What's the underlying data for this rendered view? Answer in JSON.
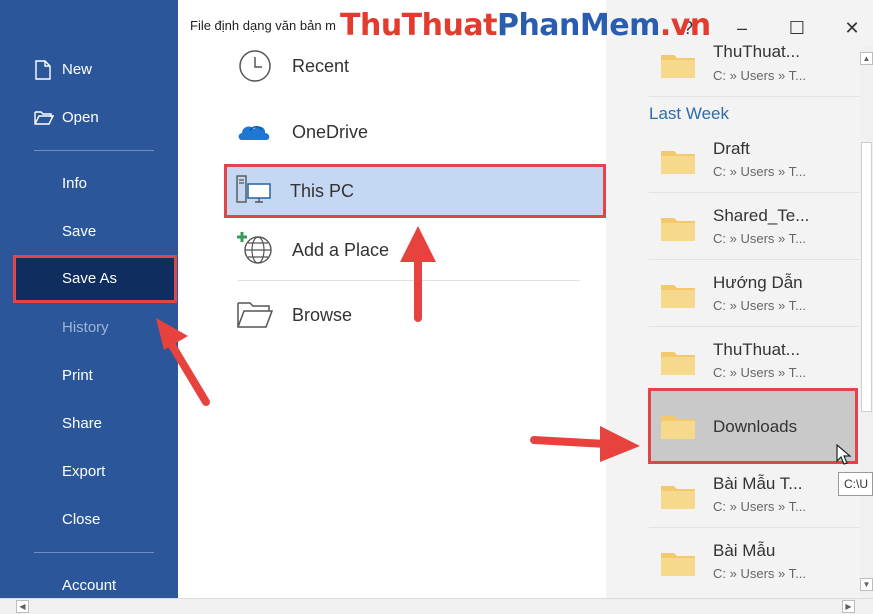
{
  "window": {
    "doc_title": "File định dạng văn bản m",
    "help_label": "?",
    "minimize_label": "–",
    "maximize_label": "☐",
    "close_label": "✕"
  },
  "watermark": {
    "part1": "ThuThuat",
    "part2": "PhanMem",
    "part3": ".vn"
  },
  "nav": {
    "new": "New",
    "open": "Open",
    "info": "Info",
    "save": "Save",
    "save_as": "Save As",
    "history": "History",
    "print": "Print",
    "share": "Share",
    "export": "Export",
    "close": "Close",
    "account": "Account"
  },
  "locations": {
    "recent": "Recent",
    "onedrive": "OneDrive",
    "this_pc": "This PC",
    "add_place": "Add a Place",
    "browse": "Browse"
  },
  "recent_folders": {
    "top": {
      "name": "ThuThuat...",
      "path": "C: » Users » T..."
    },
    "section_label": "Last Week",
    "items": [
      {
        "name": "Draft",
        "path": "C: » Users » T..."
      },
      {
        "name": "Shared_Te...",
        "path": "C: » Users » T..."
      },
      {
        "name": "Hướng Dẫn",
        "path": "C: » Users » T..."
      },
      {
        "name": "ThuThuat...",
        "path": "C: » Users » T..."
      },
      {
        "name": "Downloads",
        "path": ""
      },
      {
        "name": "Bài Mẫu T...",
        "path": "C: » Users » T..."
      },
      {
        "name": "Bài Mẫu",
        "path": "C: » Users » T..."
      }
    ]
  },
  "tooltip": "C:\\U",
  "colors": {
    "nav_bg": "#2b579a",
    "nav_active": "#0f2d5e",
    "highlight_border": "#e0454a",
    "selected_bg": "#c5d8f3"
  }
}
